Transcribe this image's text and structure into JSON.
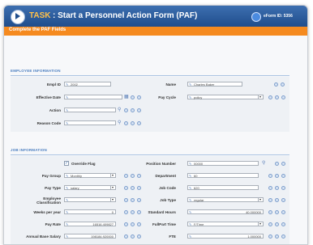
{
  "header": {
    "task_word": "TASK",
    "title": ": Start a Personnel Action Form (PAF)",
    "eform_id": "eForm ID: 5356"
  },
  "subheader": {
    "text": "Complete the PAF Fields"
  },
  "employee_section": {
    "title": "EMPLOYEE INFORMATION",
    "emplid_label": "Empl ID",
    "emplid_value": "2002",
    "name_label": "Name",
    "name_value": "Charles Baker",
    "effective_date_label": "Effective Date",
    "effective_date_value": "",
    "pay_cycle_label": "Pay Cycle",
    "pay_cycle_value": "policy",
    "action_label": "Action",
    "action_value": "",
    "reason_code_label": "Reason Code",
    "reason_code_value": ""
  },
  "job_section": {
    "title": "JOB INFORMATION",
    "override_label": "Override Flag",
    "position_number_label": "Position Number",
    "position_number_value": "00000",
    "pay_group_label": "Pay Group",
    "pay_group_value": "Monthly",
    "department_label": "Department",
    "department_value": "60",
    "pay_type_label": "Pay Type",
    "pay_type_value": "salary",
    "job_code_label": "Job Code",
    "job_code_value": "620",
    "employee_class_label": "Employee Classification",
    "employee_class_value": "",
    "job_type_label": "Job Type",
    "job_type_value": "regular",
    "weeks_label": "Weeks per year",
    "weeks_value": "0",
    "standard_hours_label": "Standard Hours",
    "standard_hours_value": "40.000000",
    "pay_rate_label": "Pay Rate",
    "pay_rate_value": "16516.409827",
    "fulltime_label": "FullPart Time",
    "fulltime_value": "F/Time",
    "annual_salary_label": "Annual Base Salary",
    "annual_salary_value": "198184.920000",
    "fte_label": "FTE",
    "fte_value": "1.000000"
  }
}
